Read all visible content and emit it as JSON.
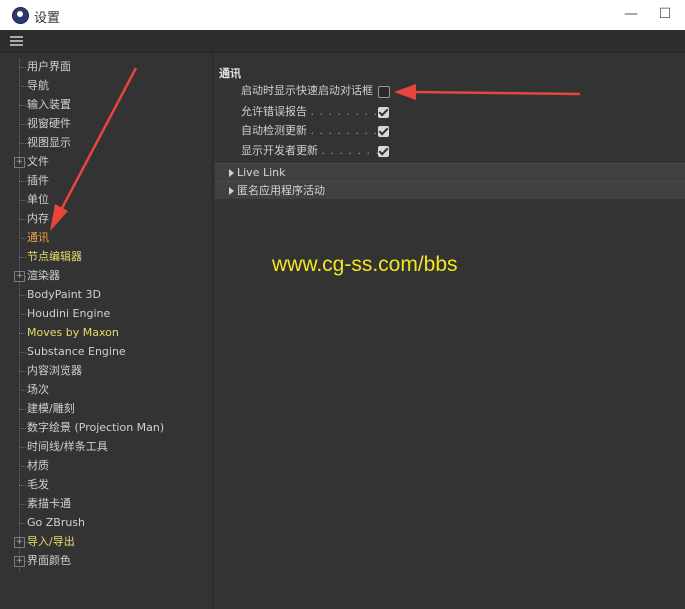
{
  "window": {
    "title": "设置",
    "minimize_glyph": "—",
    "maximize_glyph": "☐"
  },
  "sidebar": {
    "items": [
      {
        "label": "用户界面",
        "color": "normal",
        "expandable": false
      },
      {
        "label": "导航",
        "color": "normal",
        "expandable": false
      },
      {
        "label": "输入装置",
        "color": "normal",
        "expandable": false
      },
      {
        "label": "视窗硬件",
        "color": "normal",
        "expandable": false
      },
      {
        "label": "视图显示",
        "color": "normal",
        "expandable": false
      },
      {
        "label": "文件",
        "color": "normal",
        "expandable": true
      },
      {
        "label": "插件",
        "color": "normal",
        "expandable": false
      },
      {
        "label": "单位",
        "color": "normal",
        "expandable": false
      },
      {
        "label": "内存",
        "color": "normal",
        "expandable": false
      },
      {
        "label": "通讯",
        "color": "selected",
        "expandable": false
      },
      {
        "label": "节点编辑器",
        "color": "yellow",
        "expandable": false
      },
      {
        "label": "渲染器",
        "color": "normal",
        "expandable": true
      },
      {
        "label": "BodyPaint 3D",
        "color": "normal",
        "expandable": false
      },
      {
        "label": "Houdini Engine",
        "color": "normal",
        "expandable": false
      },
      {
        "label": "Moves by Maxon",
        "color": "yellow",
        "expandable": false
      },
      {
        "label": "Substance Engine",
        "color": "normal",
        "expandable": false
      },
      {
        "label": "内容浏览器",
        "color": "normal",
        "expandable": false
      },
      {
        "label": "场次",
        "color": "normal",
        "expandable": false
      },
      {
        "label": "建模/雕刻",
        "color": "normal",
        "expandable": false
      },
      {
        "label": "数字绘景 (Projection Man)",
        "color": "normal",
        "expandable": false
      },
      {
        "label": "时间线/样条工具",
        "color": "normal",
        "expandable": false
      },
      {
        "label": "材质",
        "color": "normal",
        "expandable": false
      },
      {
        "label": "毛发",
        "color": "normal",
        "expandable": false
      },
      {
        "label": "素描卡通",
        "color": "normal",
        "expandable": false
      },
      {
        "label": "Go ZBrush",
        "color": "normal",
        "expandable": false
      },
      {
        "label": "导入/导出",
        "color": "yellow",
        "expandable": true
      },
      {
        "label": "界面颜色",
        "color": "normal",
        "expandable": true
      }
    ]
  },
  "main": {
    "section_title": "通讯",
    "options": [
      {
        "label": "启动时显示快速启动对话框",
        "dots": "",
        "checked": false
      },
      {
        "label": "允许错误报告",
        "dots": ". . . . . . . . .",
        "checked": true
      },
      {
        "label": "自动检测更新",
        "dots": ". . . . . . . . .",
        "checked": true
      },
      {
        "label": "显示开发者更新",
        "dots": ". . . . . . .",
        "checked": true
      }
    ],
    "groups": [
      {
        "label": "Live Link"
      },
      {
        "label": "匿名应用程序活动"
      }
    ]
  },
  "watermark": "www.cg-ss.com/bbs",
  "colors": {
    "background": "#333333",
    "selected_text": "#f0a24a",
    "highlight_text": "#e6dc6a",
    "annotation_arrow": "#e8453c",
    "watermark": "#f0e622"
  }
}
